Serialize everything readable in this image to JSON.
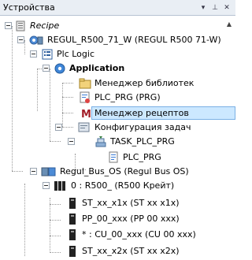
{
  "window": {
    "title": "Устройства",
    "dropdown_glyph": "▾",
    "pin_glyph": "⊥",
    "close_glyph": "✕",
    "scroll_up_glyph": "▲"
  },
  "tree": {
    "recipe": "Recipe",
    "device": "REGUL_R500_71_W (REGUL R500 71-W)",
    "plc_logic": "Plc Logic",
    "application": "Application",
    "library_manager": "Менеджер библиотек",
    "plc_prg": "PLC_PRG (PRG)",
    "recipe_manager": "Менеджер рецептов",
    "task_config": "Конфигурация задач",
    "task_plc_prg": "TASK_PLC_PRG",
    "task_plc_prg_call": "PLC_PRG",
    "bus": "Regul_Bus_OS (Regul Bus OS)",
    "rack": "0 : R500_ (R500 Крейт)",
    "module_1": "ST_xx_x1x (ST xx x1x)",
    "module_2": "PP_00_xxx (PP 00 xxx)",
    "module_3": "* : CU_00_xxx (CU 00 xxx)",
    "module_4": "ST_xx_x2x (ST xx x2x)"
  },
  "colors": {
    "selection": "#cce8ff",
    "selection_border": "#7ab0e4",
    "titlebar": "#e9eef4"
  }
}
